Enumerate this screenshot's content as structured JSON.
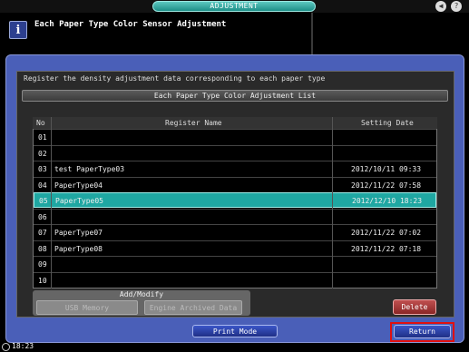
{
  "window": {
    "title": "ADJUSTMENT"
  },
  "header": {
    "title": "Each Paper Type Color Sensor Adjustment",
    "info_icon": "i"
  },
  "instruction": "Register the density adjustment data corresponding to each paper type",
  "list": {
    "title": "Each Paper Type Color Adjustment List",
    "columns": {
      "no": "No",
      "name": "Register Name",
      "date": "Setting Date"
    },
    "rows": [
      {
        "no": "01",
        "name": "",
        "date": ""
      },
      {
        "no": "02",
        "name": "",
        "date": ""
      },
      {
        "no": "03",
        "name": "test PaperType03",
        "date": "2012/10/11 09:33"
      },
      {
        "no": "04",
        "name": "PaperType04",
        "date": "2012/11/22 07:58"
      },
      {
        "no": "05",
        "name": "PaperType05",
        "date": "2012/12/10 18:23"
      },
      {
        "no": "06",
        "name": "",
        "date": ""
      },
      {
        "no": "07",
        "name": "PaperType07",
        "date": "2012/11/22 07:02"
      },
      {
        "no": "08",
        "name": "PaperType08",
        "date": "2012/11/22 07:18"
      },
      {
        "no": "09",
        "name": "",
        "date": ""
      },
      {
        "no": "10",
        "name": "",
        "date": ""
      }
    ],
    "selected_row": "05"
  },
  "add_modify": {
    "label": "Add/Modify",
    "usb_memory": "USB Memory",
    "engine_archived": "Engine Archived Data"
  },
  "buttons": {
    "delete": "Delete",
    "print_mode": "Print Mode",
    "return": "Return"
  },
  "status": {
    "time": "18:23"
  },
  "icons": {
    "top_right_1": "speaker-icon",
    "top_right_2": "help-icon",
    "clock": "clock-icon"
  },
  "colors": {
    "frame": "#4a5fb8",
    "selected_row": "#1fa7a2",
    "title_pill": "#2aa8a0",
    "return_highlight": "#e01010"
  }
}
